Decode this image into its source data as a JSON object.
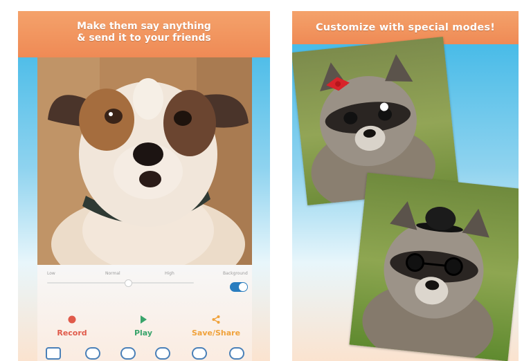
{
  "left_screen": {
    "banner": {
      "line1": "Make them say anything",
      "line2": "& send it to your friends"
    },
    "pitch_labels": [
      "Low",
      "Normal",
      "High",
      "Background"
    ],
    "pitch_level": 0.55,
    "toggle_on": true,
    "actions": {
      "record": "Record",
      "play": "Play",
      "save_share": "Save/Share"
    },
    "toolbar_icons": [
      "frame-mode-icon",
      "hat-mode-icon",
      "glasses-mode-icon",
      "mustache-mode-icon",
      "lips-mode-icon",
      "sticker-mode-icon"
    ]
  },
  "right_screen": {
    "banner": "Customize with special modes!",
    "photos": [
      "raccoon-with-red-bow",
      "raccoon-with-bowler-hat"
    ]
  },
  "colors": {
    "banner_orange": "#ef8a55",
    "record_red": "#e05a4a",
    "play_green": "#39a46b",
    "share_orange": "#f0a23b",
    "toggle_blue": "#2a7dbf"
  }
}
